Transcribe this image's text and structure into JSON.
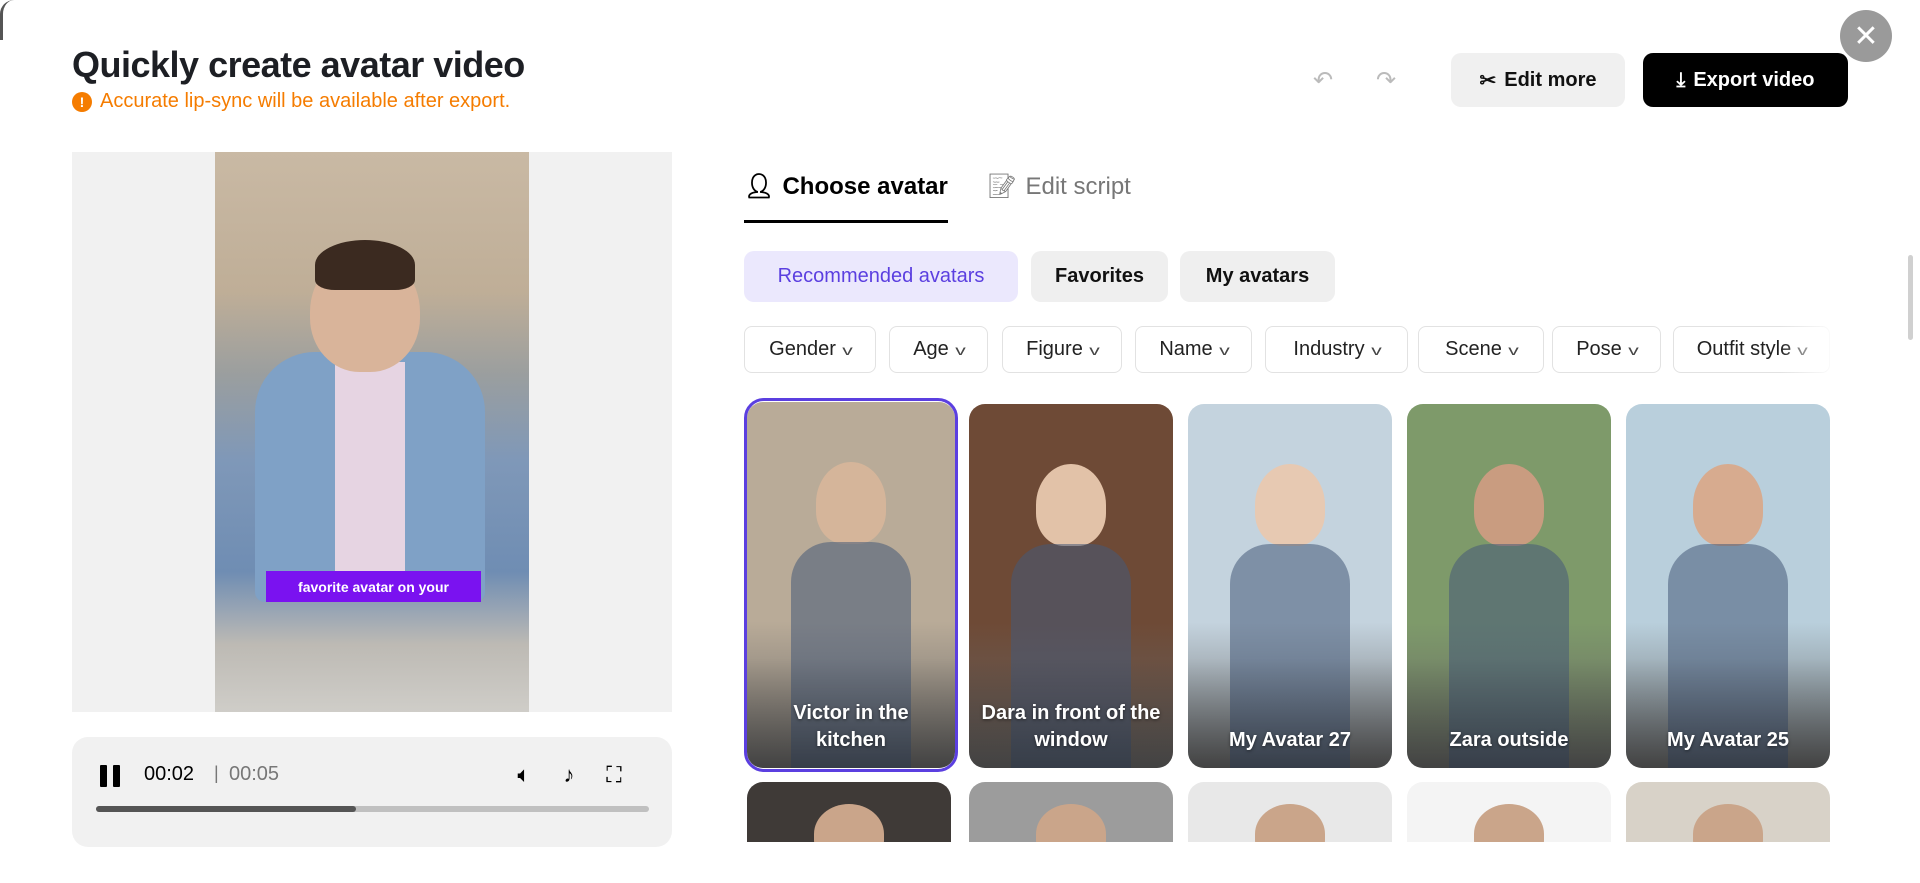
{
  "header": {
    "title": "Quickly create avatar video",
    "warning": "Accurate lip-sync will be available after export.",
    "warning_icon": "!",
    "edit_more": "Edit more",
    "export": "Export video"
  },
  "video": {
    "caption": "favorite avatar on your"
  },
  "player": {
    "current": "00:02",
    "separator": "|",
    "total": "00:05",
    "progress_fraction": 0.47
  },
  "tabs": [
    {
      "label": "Choose avatar",
      "active": true
    },
    {
      "label": "Edit script",
      "active": false
    }
  ],
  "subtabs": [
    {
      "label": "Recommended avatars",
      "active": true
    },
    {
      "label": "Favorites"
    },
    {
      "label": "My avatars"
    }
  ],
  "filters": [
    "Gender",
    "Age",
    "Figure",
    "Name",
    "Industry",
    "Scene",
    "Pose",
    "Outfit style"
  ],
  "avatars": [
    {
      "label": "Victor in the kitchen",
      "selected": true,
      "bg": "#b9ab98"
    },
    {
      "label": "Dara in front of the window",
      "bg": "#6e4a36"
    },
    {
      "label": "My Avatar 27",
      "bg": "#c4d3de"
    },
    {
      "label": "Zara outside",
      "bg": "#7e9a6a"
    },
    {
      "label": "My Avatar 25",
      "bg": "#b9cfdc"
    }
  ],
  "avatars_row2": [
    {
      "bg": "#3f3a37"
    },
    {
      "bg": "#9c9c9c"
    },
    {
      "bg": "#e8e8e8"
    },
    {
      "bg": "#f4f4f4"
    },
    {
      "bg": "#d8d2c8"
    }
  ],
  "colors": {
    "accent": "#5b3fe0",
    "warning": "#f57c00",
    "caption": "#7a12f0"
  }
}
